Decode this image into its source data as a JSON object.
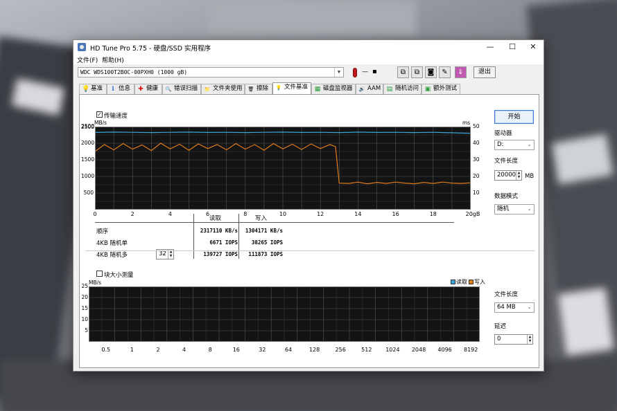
{
  "window": {
    "title": "HD Tune Pro 5.75 - 硬盘/SSD 实用程序",
    "controls": {
      "minimize": "—",
      "maximize": "☐",
      "close": "✕"
    }
  },
  "menu": {
    "file": "文件(F)",
    "help": "帮助(H)"
  },
  "toolbar": {
    "drive": "WDC WDS100T2B0C-00PXH0 (1000 gB)",
    "temperature": "—",
    "temp_icon": "thermometer-icon",
    "exit_label": "退出"
  },
  "tabs": [
    {
      "label": "基准",
      "icon": "💡"
    },
    {
      "label": "信息",
      "icon": "ℹ"
    },
    {
      "label": "健康",
      "icon": "✚"
    },
    {
      "label": "错误扫描",
      "icon": "🔍"
    },
    {
      "label": "文件夹使用",
      "icon": "📁"
    },
    {
      "label": "擦除",
      "icon": "🗑"
    },
    {
      "label": "文件基准",
      "icon": "💡"
    },
    {
      "label": "磁盘监视器",
      "icon": "▦"
    },
    {
      "label": "AAM",
      "icon": "🔊"
    },
    {
      "label": "随机访问",
      "icon": "▤"
    },
    {
      "label": "额外测试",
      "icon": "▣"
    }
  ],
  "active_tab": "文件基准",
  "transfer": {
    "checkbox_label": "传输速度",
    "checked": true,
    "y_unit": "MB/s",
    "y2_unit": "ms",
    "x_unit": "20gB"
  },
  "results": {
    "header_read": "读取",
    "header_write": "写入",
    "rows": [
      {
        "label": "顺序",
        "read": "2317110 KB/s",
        "write": "1304171 KB/s"
      },
      {
        "label": "4KB 随机单",
        "read": "6671 IOPS",
        "write": "38265 IOPS"
      },
      {
        "label": "4KB 随机多",
        "read": "139727 IOPS",
        "write": "111873 IOPS"
      }
    ],
    "queue_depth": "32"
  },
  "block": {
    "checkbox_label": "块大小测量",
    "checked": false,
    "y_unit": "MB/s",
    "legend_read": "读取",
    "legend_write": "写入",
    "read_color": "#3aa6d8",
    "write_color": "#e07b1a"
  },
  "side": {
    "start_label": "开始",
    "drive_label": "驱动器",
    "drive_value": "D:",
    "file_length_label": "文件长度",
    "file_length_value": "20000",
    "file_length_unit": "MB",
    "data_mode_label": "数据模式",
    "data_mode_value": "随机",
    "block_file_length_label": "文件长度",
    "block_file_length_value": "64 MB",
    "delay_label": "延迟",
    "delay_value": "0"
  },
  "chart_data": [
    {
      "type": "line",
      "title": "",
      "xlabel": "gB",
      "ylabel": "MB/s",
      "x_ticks": [
        "0",
        "2",
        "4",
        "6",
        "8",
        "10",
        "12",
        "14",
        "16",
        "18",
        "20gB"
      ],
      "y_ticks": [
        "500",
        "1000",
        "1500",
        "2000",
        "2500"
      ],
      "y2_ticks": [
        "10",
        "20",
        "30",
        "40",
        "50"
      ],
      "xlim": [
        0,
        20
      ],
      "ylim": [
        0,
        2500
      ],
      "y2lim": [
        0,
        50
      ],
      "grid": true,
      "series": [
        {
          "name": "读取",
          "axis": "ms",
          "color": "#3aa6d8",
          "x": [
            0,
            1,
            2,
            3,
            4,
            5,
            6,
            7,
            8,
            9,
            10,
            11,
            12,
            13,
            14,
            15,
            16,
            17,
            18,
            19,
            20
          ],
          "values": [
            46.5,
            46.7,
            46.6,
            46.4,
            46.6,
            46.7,
            46.5,
            46.6,
            46.4,
            46.6,
            46.7,
            46.5,
            46.6,
            46.4,
            46.7,
            46.5,
            46.6,
            46.4,
            46.6,
            46.3,
            46.0
          ]
        },
        {
          "name": "写入",
          "axis": "MB/s",
          "color": "#e07b1a",
          "x": [
            0,
            0.5,
            1,
            1.5,
            2,
            2.5,
            3,
            3.5,
            4,
            4.5,
            5,
            5.5,
            6,
            6.5,
            7,
            7.5,
            8,
            8.5,
            9,
            9.5,
            10,
            10.5,
            11,
            11.5,
            12,
            12.5,
            12.8,
            13.0,
            13.5,
            14,
            14.5,
            15,
            15.5,
            16,
            16.5,
            17,
            17.5,
            18,
            18.5,
            19,
            19.5,
            20
          ],
          "values": [
            1750,
            1960,
            1800,
            1990,
            1820,
            1950,
            1780,
            2000,
            1830,
            1970,
            1790,
            1980,
            1840,
            1960,
            1800,
            1990,
            1820,
            1960,
            1790,
            1990,
            1830,
            1970,
            1810,
            1980,
            1840,
            1960,
            1900,
            800,
            790,
            830,
            780,
            820,
            790,
            830,
            800,
            780,
            820,
            790,
            830,
            800,
            790,
            810
          ]
        }
      ]
    },
    {
      "type": "bar",
      "title": "",
      "xlabel": "",
      "ylabel": "MB/s",
      "categories": [
        "0.5",
        "1",
        "2",
        "4",
        "8",
        "16",
        "32",
        "64",
        "128",
        "256",
        "512",
        "1024",
        "2048",
        "4096",
        "8192"
      ],
      "y_ticks": [
        "5",
        "10",
        "15",
        "20",
        "25"
      ],
      "ylim": [
        0,
        25
      ],
      "grid": true,
      "series": []
    }
  ]
}
